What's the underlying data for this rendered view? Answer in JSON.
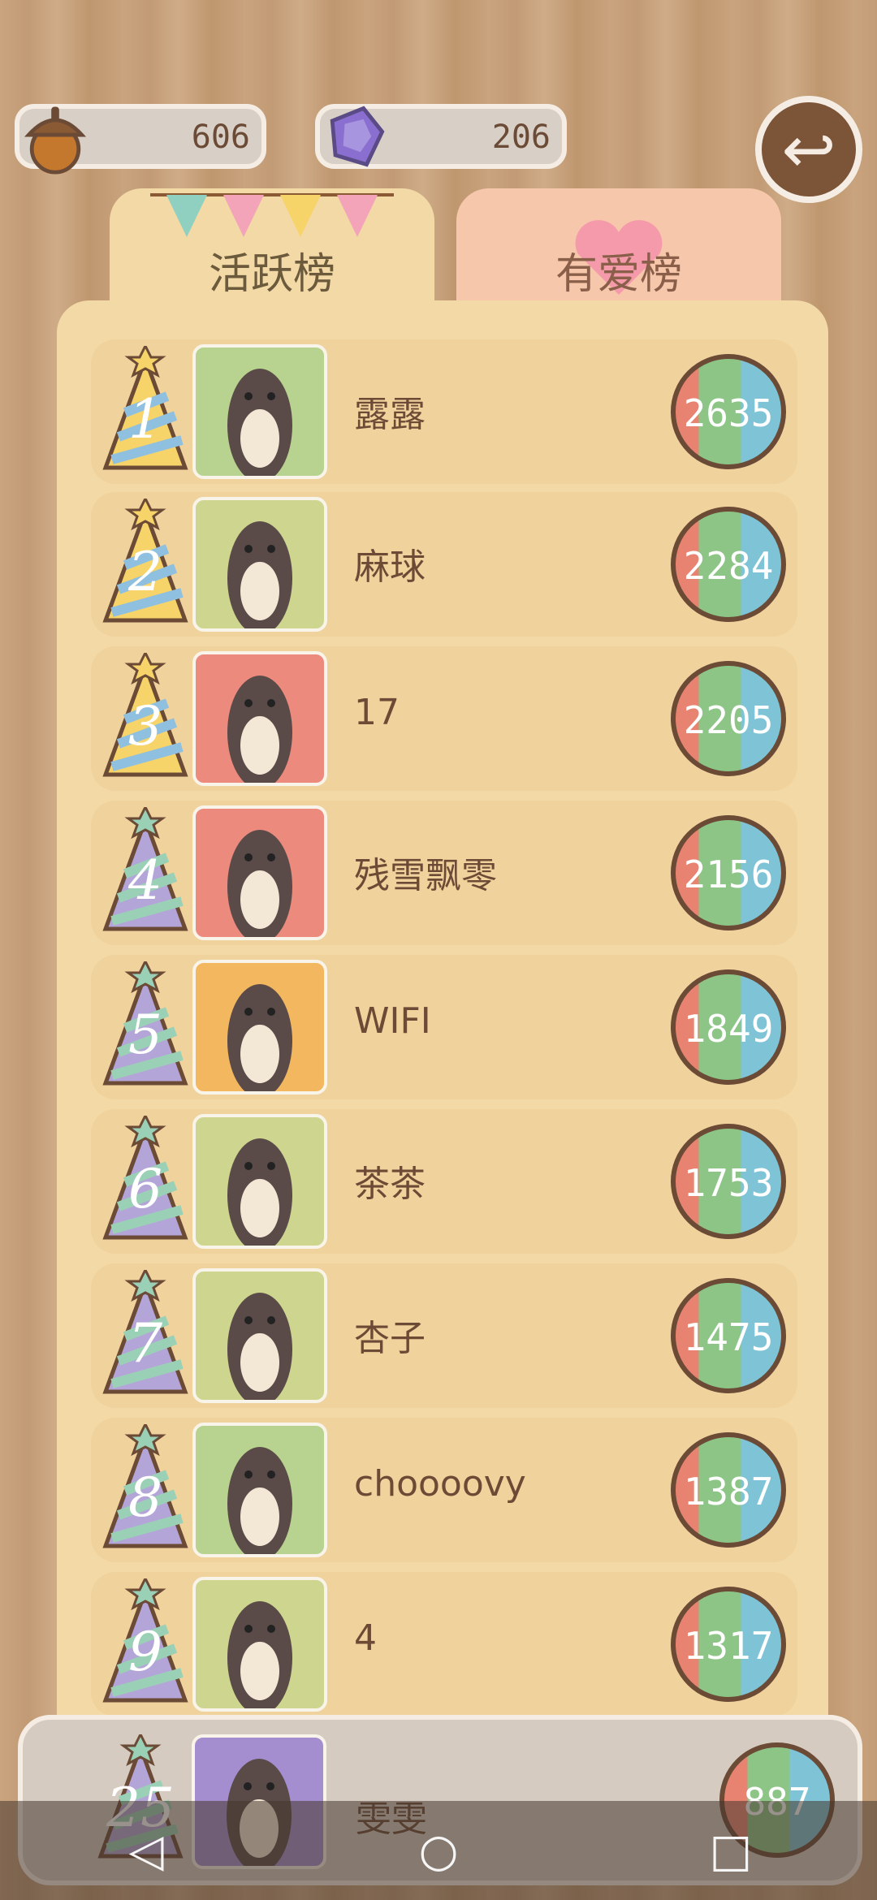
{
  "resources": {
    "acorns": "606",
    "gems": "206"
  },
  "tabs": {
    "active": "活跃榜",
    "inactive": "有爱榜"
  },
  "rows": [
    {
      "rank": "1",
      "name": "露露",
      "score": "2635",
      "hat": "rainbow",
      "avatar": "#b8d38f"
    },
    {
      "rank": "2",
      "name": "麻球",
      "score": "2284",
      "hat": "rainbow",
      "avatar": "#cdd58e"
    },
    {
      "rank": "3",
      "name": "17",
      "score": "2205",
      "hat": "rainbow",
      "avatar": "#ec8a7e"
    },
    {
      "rank": "4",
      "name": "残雪飘零",
      "score": "2156",
      "hat": "purple-green",
      "avatar": "#ec8a7e"
    },
    {
      "rank": "5",
      "name": "WIFI",
      "score": "1849",
      "hat": "purple-green",
      "avatar": "#f3b760"
    },
    {
      "rank": "6",
      "name": "茶茶",
      "score": "1753",
      "hat": "purple-green",
      "avatar": "#cdd58e"
    },
    {
      "rank": "7",
      "name": "杏子",
      "score": "1475",
      "hat": "purple-green",
      "avatar": "#cdd58e"
    },
    {
      "rank": "8",
      "name": "choooovy",
      "score": "1387",
      "hat": "purple-green",
      "avatar": "#b8d38f"
    },
    {
      "rank": "9",
      "name": "4",
      "score": "1317",
      "hat": "purple-green",
      "avatar": "#cdd58e"
    }
  ],
  "self": {
    "rank": "25",
    "name": "雯雯",
    "score": "887",
    "avatar": "#a58ed0"
  }
}
